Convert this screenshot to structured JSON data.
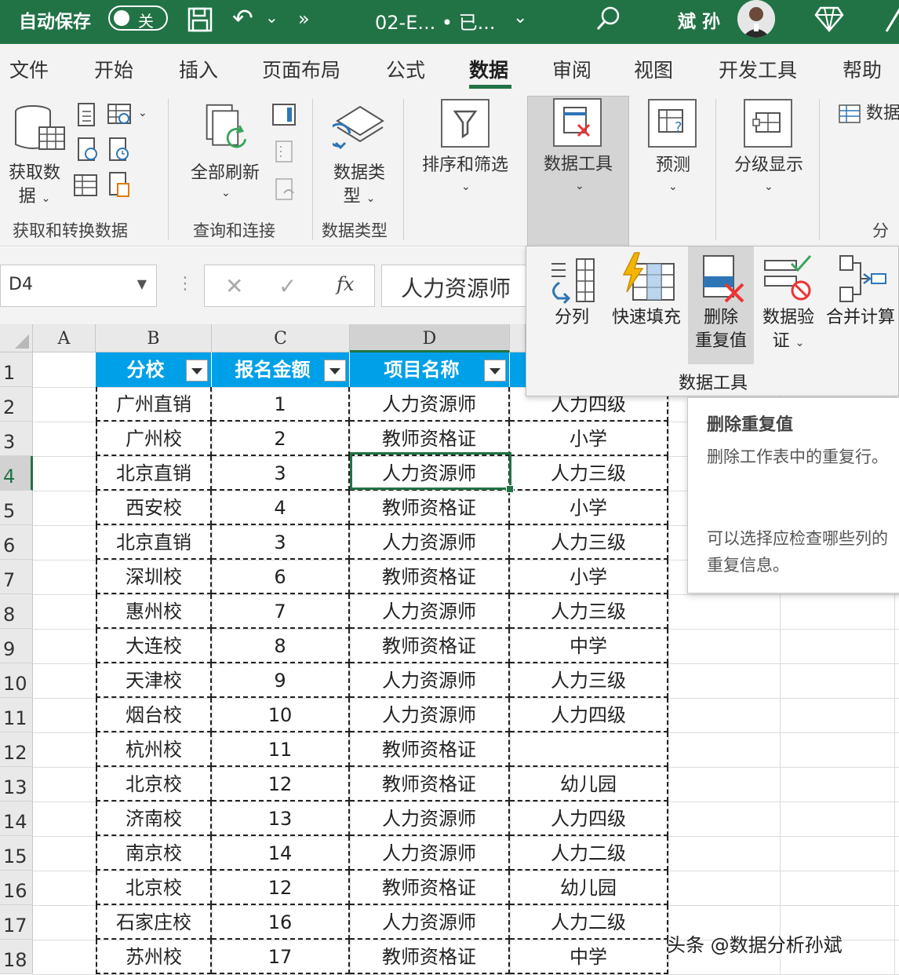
{
  "titlebar": {
    "autosave_label": "自动保存",
    "autosave_state": "关",
    "file_name": "02-E...",
    "file_status": "• 已...",
    "user_name": "斌 孙"
  },
  "menu": {
    "tabs": [
      "文件",
      "开始",
      "插入",
      "页面布局",
      "公式",
      "数据",
      "审阅",
      "视图",
      "开发工具",
      "帮助"
    ],
    "active_tab": "数据"
  },
  "ribbon": {
    "get_data": "获取数据",
    "get_data_line1": "获取数",
    "get_data_line2": "据",
    "group_get_transform": "获取和转换数据",
    "refresh_all": "全部刷新",
    "group_queries": "查询和连接",
    "data_types_line1": "数据类",
    "data_types_line2": "型",
    "group_data_types": "数据类型",
    "sort_filter": "排序和筛选",
    "data_tools": "数据工具",
    "forecast": "预测",
    "outline": "分级显示",
    "data_analysis": "数据",
    "analysis_group_partial": "分"
  },
  "formula_bar": {
    "name_box": "D4",
    "content": "人力资源师"
  },
  "grid": {
    "col_headers": [
      "A",
      "B",
      "C",
      "D"
    ],
    "row_headers": [
      "1",
      "2",
      "3",
      "4",
      "5",
      "6",
      "7",
      "8",
      "9",
      "10",
      "11",
      "12",
      "13",
      "14",
      "15",
      "16",
      "17",
      "18"
    ],
    "selected_cell": "D4",
    "table_headers": [
      "分校",
      "报名金额",
      "项目名称"
    ],
    "header_color": "#00a0e9",
    "rows": [
      [
        "广州直销",
        "1",
        "人力资源师",
        "人力四级"
      ],
      [
        "广州校",
        "2",
        "教师资格证",
        "小学"
      ],
      [
        "北京直销",
        "3",
        "人力资源师",
        "人力三级"
      ],
      [
        "西安校",
        "4",
        "教师资格证",
        "小学"
      ],
      [
        "北京直销",
        "3",
        "人力资源师",
        "人力三级"
      ],
      [
        "深圳校",
        "6",
        "教师资格证",
        "小学"
      ],
      [
        "惠州校",
        "7",
        "人力资源师",
        "人力三级"
      ],
      [
        "大连校",
        "8",
        "教师资格证",
        "中学"
      ],
      [
        "天津校",
        "9",
        "人力资源师",
        "人力三级"
      ],
      [
        "烟台校",
        "10",
        "人力资源师",
        "人力四级"
      ],
      [
        "杭州校",
        "11",
        "教师资格证",
        ""
      ],
      [
        "北京校",
        "12",
        "教师资格证",
        "幼儿园"
      ],
      [
        "济南校",
        "13",
        "人力资源师",
        "人力四级"
      ],
      [
        "南京校",
        "14",
        "人力资源师",
        "人力二级"
      ],
      [
        "北京校",
        "12",
        "教师资格证",
        "幼儿园"
      ],
      [
        "石家庄校",
        "16",
        "人力资源师",
        "人力二级"
      ],
      [
        "苏州校",
        "17",
        "教师资格证",
        "中学"
      ]
    ]
  },
  "data_tools_panel": {
    "text_to_columns": "分列",
    "flash_fill": "快速填充",
    "remove_dup_line1": "删除",
    "remove_dup_line2": "重复值",
    "validation_line1": "数据验",
    "validation_line2": "证",
    "consolidate": "合并计算",
    "group_label": "数据工具"
  },
  "tooltip": {
    "title": "删除重复值",
    "body1": "删除工作表中的重复行。",
    "body2": "可以选择应检查哪些列的重复信息。"
  },
  "watermark": "头条 @数据分析孙斌",
  "colors": {
    "excel_green": "#217346",
    "header_blue": "#00a0e9"
  }
}
